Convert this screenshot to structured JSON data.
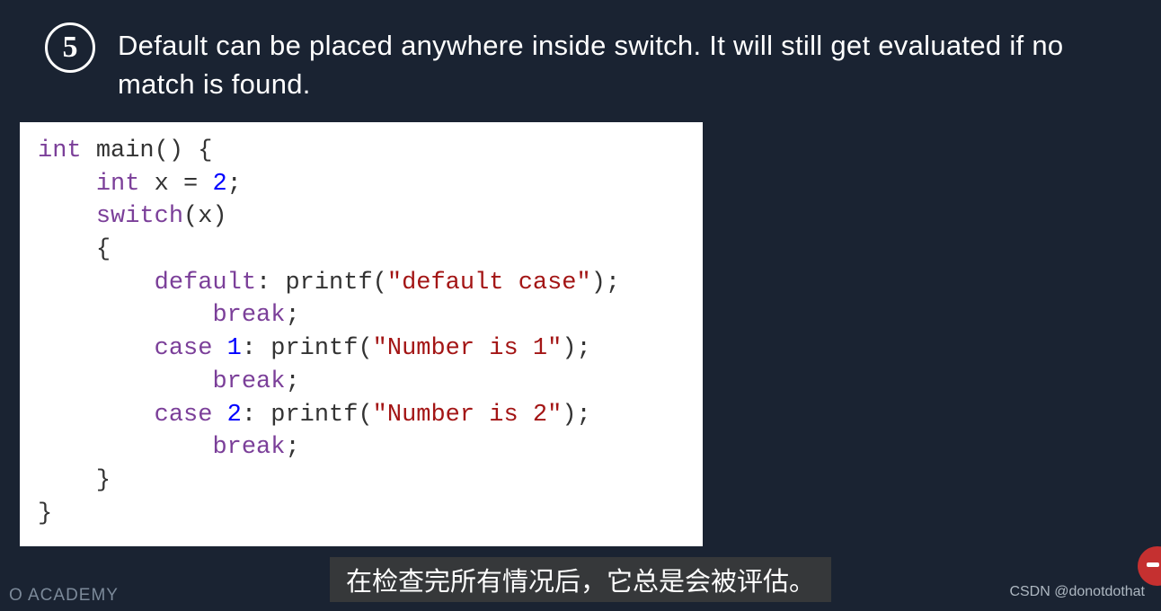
{
  "header": {
    "number": "5",
    "title": "Default can be placed anywhere inside switch. It will still get evaluated if no match is found."
  },
  "code": {
    "l1_kw": "int",
    "l1_fn": "main",
    "l1_rest": "() {",
    "l2_kw": "int",
    "l2_var": "x ",
    "l2_op": "= ",
    "l2_num": "2",
    "l2_end": ";",
    "l3_kw": "switch",
    "l3_rest": "(x)",
    "l4": "{",
    "l5_kw": "default",
    "l5_colon": ": ",
    "l5_fn": "printf",
    "l5_p1": "(",
    "l5_str": "\"default case\"",
    "l5_p2": ");",
    "l6_kw": "break",
    "l6_end": ";",
    "l7_kw": "case",
    "l7_sp": " ",
    "l7_num": "1",
    "l7_colon": ": ",
    "l7_fn": "printf",
    "l7_p1": "(",
    "l7_str": "\"Number is 1\"",
    "l7_p2": ");",
    "l8_kw": "break",
    "l8_end": ";",
    "l9_kw": "case",
    "l9_sp": " ",
    "l9_num": "2",
    "l9_colon": ": ",
    "l9_fn": "printf",
    "l9_p1": "(",
    "l9_str": "\"Number is 2\"",
    "l9_p2": ");",
    "l10_kw": "break",
    "l10_end": ";",
    "l11": "}",
    "l12": "}"
  },
  "subtitle": "在检查完所有情况后，它总是会被评估。",
  "footer": {
    "left": "O ACADEMY",
    "right": "CSDN @donotdothat"
  }
}
